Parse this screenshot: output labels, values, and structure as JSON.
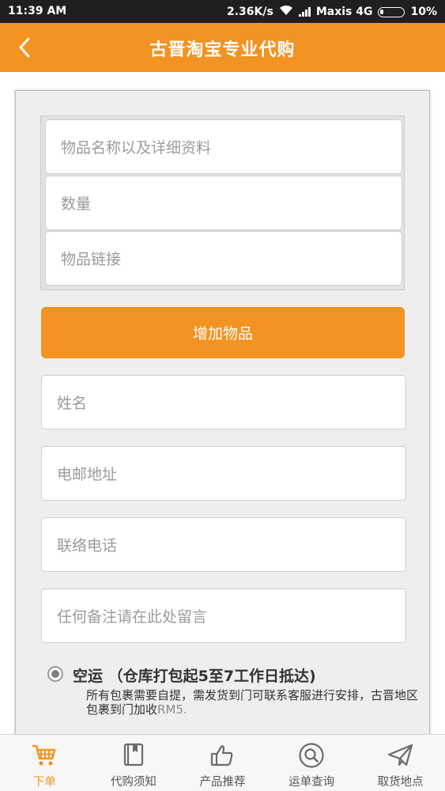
{
  "status_bar": {
    "time": "11:39 AM",
    "speed": "2.36K/s",
    "carrier": "Maxis 4G",
    "battery": "10%"
  },
  "header": {
    "title": "古晋淘宝专业代购"
  },
  "form": {
    "item_name_placeholder": "物品名称以及详细资料",
    "quantity_placeholder": "数量",
    "item_link_placeholder": "物品链接",
    "add_item_label": "增加物品",
    "name_placeholder": "姓名",
    "email_placeholder": "电邮地址",
    "phone_placeholder": "联络电话",
    "remark_placeholder": "任何备注请在此处留言"
  },
  "shipping": {
    "option_label": "空运 （仓库打包起5至7工作日抵达)",
    "description": "所有包裹需要自提，需发货到门可联系客服进行安排，古晋地区包裹到门加收",
    "fee": "RM5."
  },
  "tabs": [
    {
      "label": "下单",
      "icon": "cart-icon",
      "active": true
    },
    {
      "label": "代购须知",
      "icon": "book-icon",
      "active": false
    },
    {
      "label": "产品推荐",
      "icon": "thumbs-up-icon",
      "active": false
    },
    {
      "label": "运单查询",
      "icon": "search-icon",
      "active": false
    },
    {
      "label": "取货地点",
      "icon": "paper-plane-icon",
      "active": false
    }
  ],
  "colors": {
    "accent": "#f39322",
    "status_bar": "#1f1f1f",
    "panel": "#eeeeee"
  }
}
